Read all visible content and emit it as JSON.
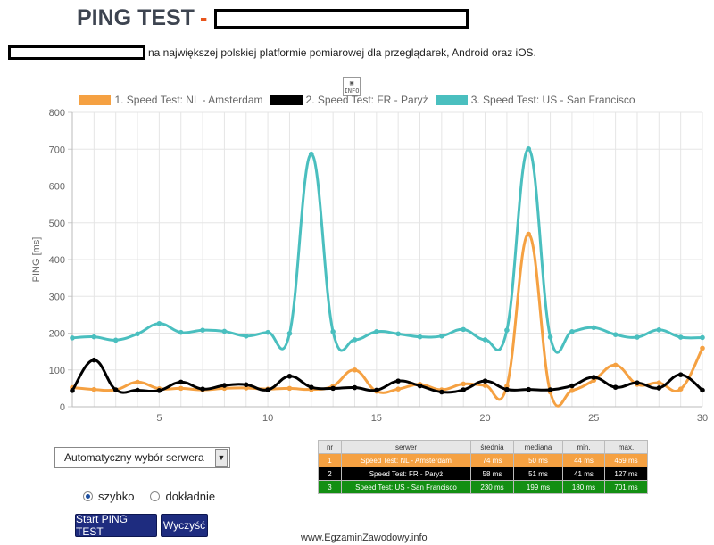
{
  "header": {
    "title": "PING TEST",
    "title_dash": "-"
  },
  "subtitle": "na największej polskiej platformie pomiarowej dla przeglądarek, Android oraz iOS.",
  "broken_image_text": "INFO",
  "colors": {
    "nl": "#f5a142",
    "fr": "#000000",
    "us": "#4abfbf",
    "grid": "#e5e5e5",
    "button": "#1e2c7f"
  },
  "chart_data": {
    "type": "line",
    "ylabel": "PING [ms]",
    "xlabel": "",
    "xlim": [
      1,
      30
    ],
    "ylim": [
      0,
      800
    ],
    "yticks": [
      0,
      100,
      200,
      300,
      400,
      500,
      600,
      700,
      800
    ],
    "xticks": [
      5,
      10,
      15,
      20,
      25,
      30
    ],
    "x": [
      1,
      2,
      3,
      4,
      5,
      6,
      7,
      8,
      9,
      10,
      11,
      12,
      13,
      14,
      15,
      16,
      17,
      18,
      19,
      20,
      21,
      22,
      23,
      24,
      25,
      26,
      27,
      28,
      29,
      30
    ],
    "series": [
      {
        "name": "1. Speed Test: NL - Amsterdam",
        "color": "#f5a142",
        "values": [
          52,
          47,
          46,
          67,
          49,
          50,
          46,
          50,
          51,
          48,
          50,
          47,
          56,
          100,
          42,
          48,
          61,
          46,
          62,
          58,
          56,
          469,
          40,
          44,
          72,
          113,
          61,
          65,
          48,
          159
        ]
      },
      {
        "name": "2. Speed Test: FR - Paryż",
        "color": "#000000",
        "values": [
          44,
          127,
          46,
          45,
          44,
          67,
          48,
          58,
          60,
          46,
          83,
          53,
          50,
          52,
          45,
          70,
          57,
          40,
          46,
          70,
          47,
          47,
          46,
          57,
          80,
          53,
          65,
          51,
          87,
          45
        ]
      },
      {
        "name": "3. Speed Test: US - San Francisco",
        "color": "#4abfbf",
        "values": [
          187,
          190,
          181,
          198,
          226,
          202,
          208,
          205,
          192,
          202,
          199,
          687,
          204,
          182,
          204,
          198,
          190,
          192,
          210,
          182,
          208,
          701,
          189,
          204,
          215,
          196,
          189,
          209,
          189,
          188
        ]
      }
    ]
  },
  "controls": {
    "server_select": "Automatyczny wybór serwera",
    "radio_fast": "szybko",
    "radio_exact": "dokładnie",
    "start_button": "Start PING TEST",
    "clear_button": "Wyczyść"
  },
  "table": {
    "headers": [
      "nr",
      "serwer",
      "średnia",
      "mediana",
      "min.",
      "max."
    ],
    "rows": [
      {
        "cells": [
          "1",
          "Speed Test: NL - Amsterdam",
          "74 ms",
          "50 ms",
          "44 ms",
          "469 ms"
        ],
        "bg": "#f5a142",
        "fg": "#ffffff"
      },
      {
        "cells": [
          "2",
          "Speed Test: FR - Paryż",
          "58 ms",
          "51 ms",
          "41 ms",
          "127 ms"
        ],
        "bg": "#000000",
        "fg": "#ffffff"
      },
      {
        "cells": [
          "3",
          "Speed Test: US - San Francisco",
          "230 ms",
          "199 ms",
          "180 ms",
          "701 ms"
        ],
        "bg": "#138f13",
        "fg": "#ffffff"
      }
    ]
  },
  "watermark": "www.EgzaminZawodowy.info"
}
